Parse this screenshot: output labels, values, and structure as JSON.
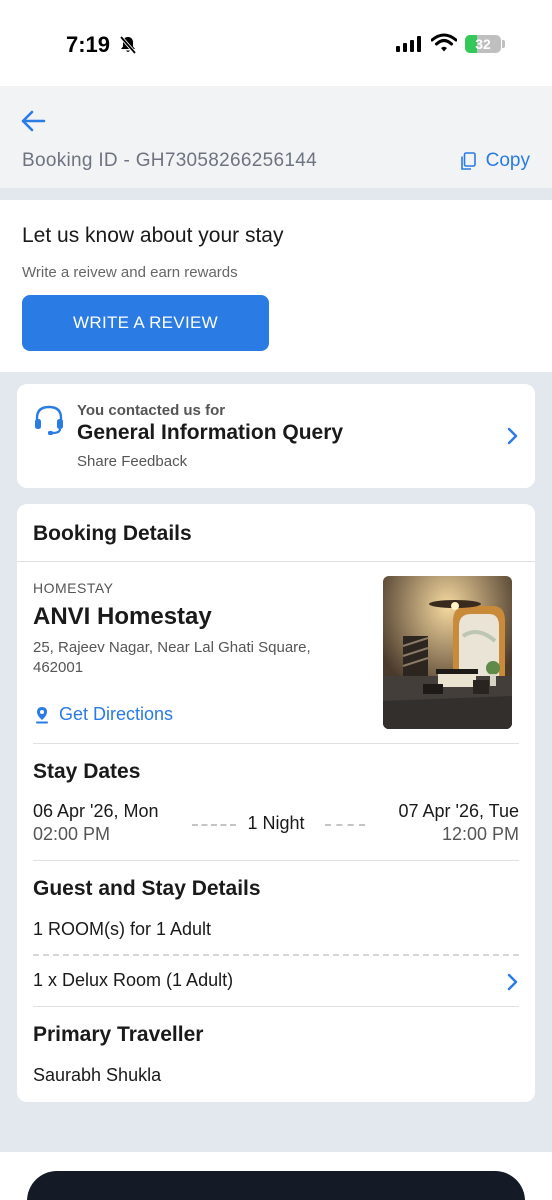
{
  "status_bar": {
    "time": "7:19",
    "battery": "32",
    "battery_level": 0.32
  },
  "header": {
    "booking_id": "Booking ID - GH73058266256144",
    "copy_label": "Copy"
  },
  "review": {
    "title": "Let us know about your stay",
    "subtitle": "Write a reivew and earn rewards",
    "button_label": "WRITE A REVIEW"
  },
  "contact": {
    "pre": "You contacted us for",
    "title": "General Information Query",
    "feedback": "Share Feedback"
  },
  "booking": {
    "title": "Booking Details",
    "property_type": "HOMESTAY",
    "property_name": "ANVI Homestay",
    "address": "25, Rajeev Nagar, Near Lal Ghati Square, 462001",
    "directions_label": "Get Directions"
  },
  "stay": {
    "title": "Stay Dates",
    "checkin_date": "06 Apr '26, Mon",
    "checkin_time": "02:00 PM",
    "nights": "1 Night",
    "checkout_date": "07 Apr '26, Tue",
    "checkout_time": "12:00 PM"
  },
  "guest": {
    "title": "Guest and Stay Details",
    "rooms": "1 ROOM(s) for 1 Adult",
    "room_type": "1 x Delux Room (1 Adult)"
  },
  "traveller": {
    "title": "Primary Traveller",
    "name": "Saurabh Shukla"
  },
  "colors": {
    "accent": "#2a7be4",
    "background": "#e3e8ef",
    "battery_green": "#34c759",
    "bottom_bar": "#141a26"
  },
  "icons": [
    "bell-slash-icon",
    "signal-icon",
    "wifi-icon",
    "battery-icon",
    "back-arrow-icon",
    "copy-icon",
    "headset-icon",
    "chevron-right-icon",
    "location-pin-icon"
  ]
}
